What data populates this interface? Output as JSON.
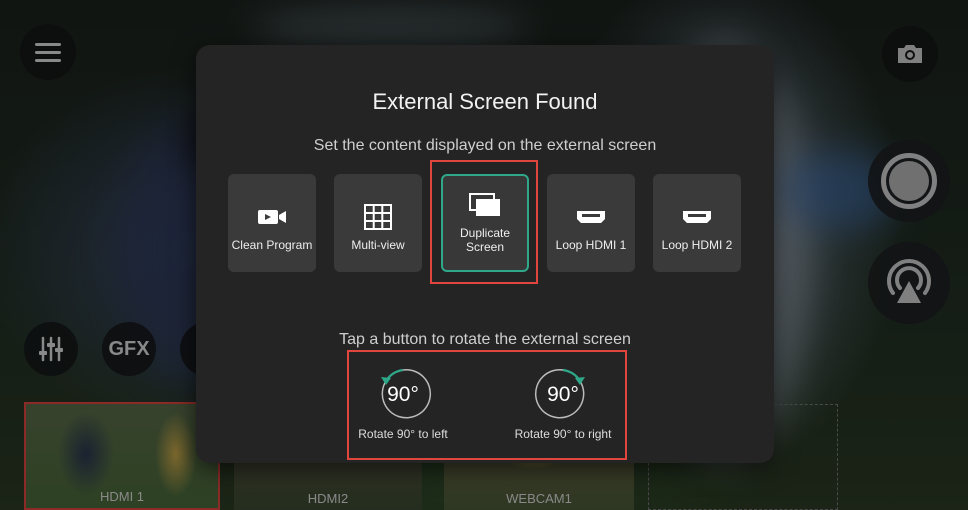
{
  "modal": {
    "title": "External Screen Found",
    "subtitle": "Set the content displayed on the external screen",
    "options": [
      {
        "label": "Clean Program",
        "icon": "video-camera-icon"
      },
      {
        "label": "Multi-view",
        "icon": "grid-icon"
      },
      {
        "label": "Duplicate\nScreen",
        "icon": "duplicate-screens-icon",
        "selected": true
      },
      {
        "label": "Loop HDMI 1",
        "icon": "hdmi-port-icon"
      },
      {
        "label": "Loop HDMI 2",
        "icon": "hdmi-port-icon"
      }
    ],
    "rotate_subtitle": "Tap a button to rotate the external screen",
    "rotate_left": {
      "value": "90°",
      "label": "Rotate 90° to left"
    },
    "rotate_right": {
      "value": "90°",
      "label": "Rotate 90° to right"
    }
  },
  "left_controls": {
    "gfx_label": "GFX"
  },
  "sources": [
    {
      "label": "HDMI 1",
      "active": true
    },
    {
      "label": "HDMI2"
    },
    {
      "label": "WEBCAM1"
    }
  ],
  "colors": {
    "accent_teal": "#2fa88a",
    "highlight_red": "#e0453e",
    "modal_bg": "#242424",
    "option_bg": "#3a3a3a"
  }
}
